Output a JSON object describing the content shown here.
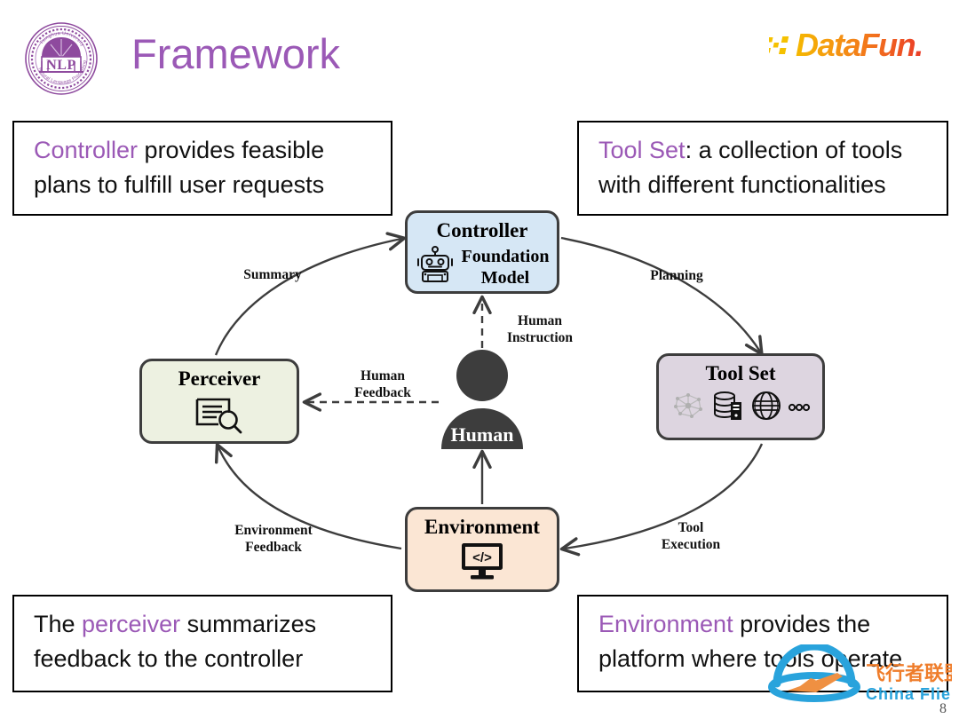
{
  "header": {
    "title": "Framework",
    "title_color": "#9b59b6",
    "left_logo": "nlp-circular-emblem-logo",
    "left_logo_text": "NLP",
    "left_logo_outer_text_top": "Tsinghua University",
    "left_logo_outer_text_bottom": "Natural Language Processing",
    "right_logo": "datafun-logo",
    "right_logo_text": "DataFun."
  },
  "captions": {
    "top_left": {
      "highlight": "Controller",
      "rest": " provides feasible plans to fulfill user requests"
    },
    "top_right": {
      "highlight": "Tool Set",
      "rest": ": a collection of tools with different functionalities"
    },
    "bottom_left": {
      "prefix": "The ",
      "highlight": "perceiver",
      "rest": " summarizes feedback to the controller"
    },
    "bottom_right": {
      "highlight": "Environment",
      "rest": " provides the platform where tools operate"
    }
  },
  "diagram": {
    "nodes": {
      "controller": {
        "title": "Controller",
        "sub_line1": "Foundation",
        "sub_line2": "Model",
        "icon": "robot-icon",
        "color": "#d6e7f5"
      },
      "tool_set": {
        "title": "Tool Set",
        "icons": [
          "network-graph-icon",
          "database-server-icon",
          "globe-icon",
          "ellipsis-icon"
        ],
        "ellipsis": "ooo",
        "color": "#ddd5e0"
      },
      "perceiver": {
        "title": "Perceiver",
        "icon": "document-search-icon",
        "color": "#edf1e1"
      },
      "environment": {
        "title": "Environment",
        "icon": "monitor-code-icon",
        "icon_text": "</>",
        "color": "#fbe6d4"
      },
      "human": {
        "title": "Human",
        "icon": "person-silhouette-icon",
        "color": "#3d3d3d"
      }
    },
    "edges": {
      "summary": "Summary",
      "planning": "Planning",
      "human_instruction": "Human\nInstruction",
      "human_feedback": "Human\nFeedback",
      "environment_feedback": "Environment\nFeedback",
      "tool_execution": "Tool\nExecution"
    }
  },
  "watermark": {
    "cn_text": "飞行者联盟",
    "en_text": "China Flier",
    "icon": "plane-arc-logo-icon"
  },
  "page_number": "8"
}
